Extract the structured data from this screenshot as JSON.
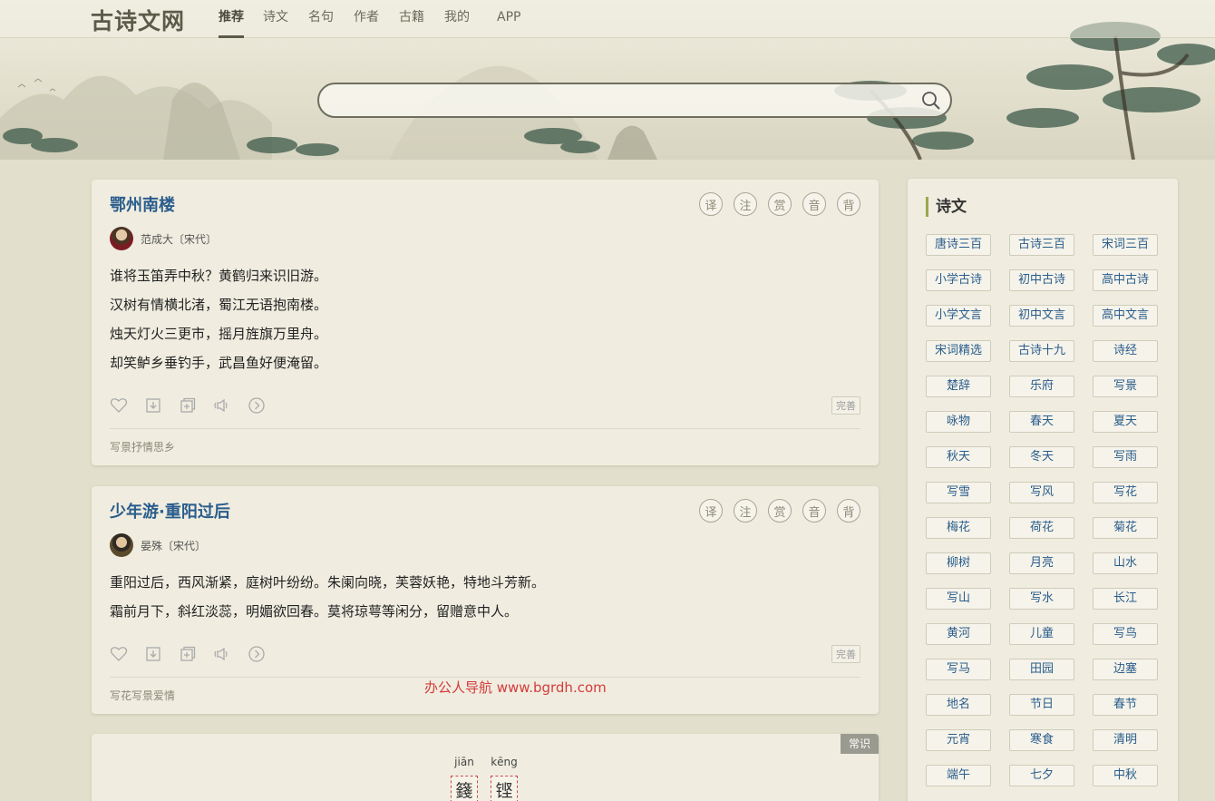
{
  "site": {
    "logo": "古诗文网",
    "nav": [
      "推荐",
      "诗文",
      "名句",
      "作者",
      "古籍",
      "我的",
      "APP"
    ],
    "active_nav": "推荐",
    "search": {
      "placeholder": ""
    }
  },
  "poems": [
    {
      "title": "鄂州南楼",
      "tools": [
        "译",
        "注",
        "赏",
        "音",
        "背"
      ],
      "author": "范成大〔宋代〕",
      "lines": [
        "谁将玉笛弄中秋？黄鹤归来识旧游。",
        "汉树有情横北渚，蜀江无语抱南楼。",
        "烛天灯火三更市，摇月旌旗万里舟。",
        "却笑鲈乡垂钓手，武昌鱼好便淹留。"
      ],
      "complete_label": "完善",
      "tags": "写景抒情思乡"
    },
    {
      "title": "少年游·重阳过后",
      "tools": [
        "译",
        "注",
        "赏",
        "音",
        "背"
      ],
      "author": "晏殊〔宋代〕",
      "lines": [
        "重阳过后，西风渐紧，庭树叶纷纷。朱阑向晓，芙蓉妖艳，特地斗芳新。",
        "霜前月下，斜红淡蕊，明媚欲回春。莫将琼萼等闲分，留赠意中人。"
      ],
      "complete_label": "完善",
      "tags": "写花写景爱情"
    }
  ],
  "knowledge_card": {
    "badge": "常识",
    "pinyin": [
      {
        "py": "jiān",
        "char": "籛"
      },
      {
        "py": "kēng",
        "char": "铿"
      }
    ]
  },
  "watermark": "办公人导航 www.bgrdh.com",
  "sidebar": {
    "title": "诗文",
    "items": [
      "唐诗三百",
      "古诗三百",
      "宋词三百",
      "小学古诗",
      "初中古诗",
      "高中古诗",
      "小学文言",
      "初中文言",
      "高中文言",
      "宋词精选",
      "古诗十九",
      "诗经",
      "楚辞",
      "乐府",
      "写景",
      "咏物",
      "春天",
      "夏天",
      "秋天",
      "冬天",
      "写雨",
      "写雪",
      "写风",
      "写花",
      "梅花",
      "荷花",
      "菊花",
      "柳树",
      "月亮",
      "山水",
      "写山",
      "写水",
      "长江",
      "黄河",
      "儿童",
      "写鸟",
      "写马",
      "田园",
      "边塞",
      "地名",
      "节日",
      "春节",
      "元宵",
      "寒食",
      "清明",
      "端午",
      "七夕",
      "中秋"
    ]
  }
}
